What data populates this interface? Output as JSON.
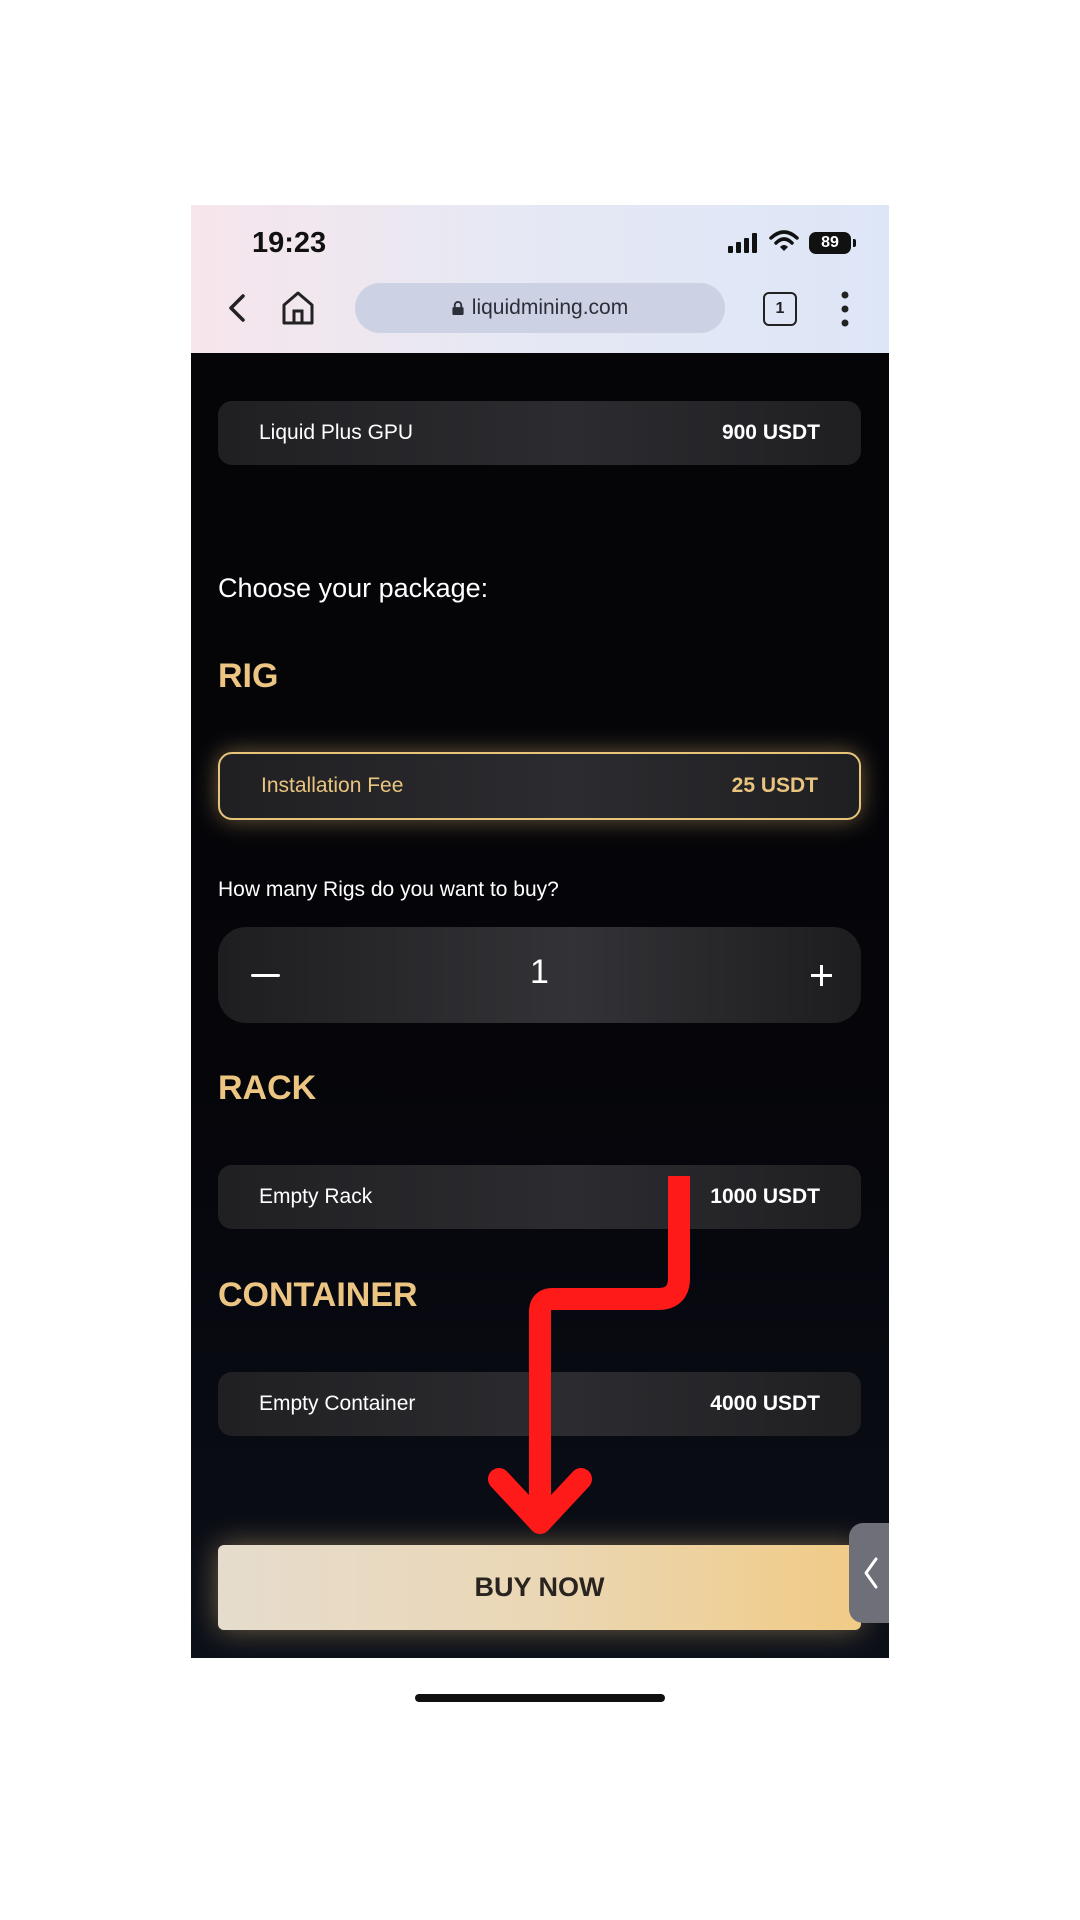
{
  "status_bar": {
    "time": "19:23",
    "battery": "89"
  },
  "browser": {
    "url": "liquidmining.com",
    "tab_count": "1"
  },
  "top_card": {
    "label": "Liquid Plus GPU",
    "price": "900 USDT"
  },
  "choose_heading": "Choose your package:",
  "rig": {
    "title": "RIG",
    "fee_label": "Installation Fee",
    "fee_price": "25 USDT",
    "question": "How many Rigs do you want to buy?",
    "quantity": "1"
  },
  "rack": {
    "title": "RACK",
    "label": "Empty Rack",
    "price": "1000 USDT"
  },
  "container": {
    "title": "CONTAINER",
    "label": "Empty Container",
    "price": "4000 USDT"
  },
  "buy_button": "BUY NOW",
  "colors": {
    "accent_gold": "#ecc582",
    "annotation_red": "#ff1a1a"
  },
  "icons": [
    "signal-icon",
    "wifi-icon",
    "battery-icon",
    "back-icon",
    "home-icon",
    "lock-icon",
    "tabs-icon",
    "more-icon",
    "chevron-left-icon"
  ]
}
